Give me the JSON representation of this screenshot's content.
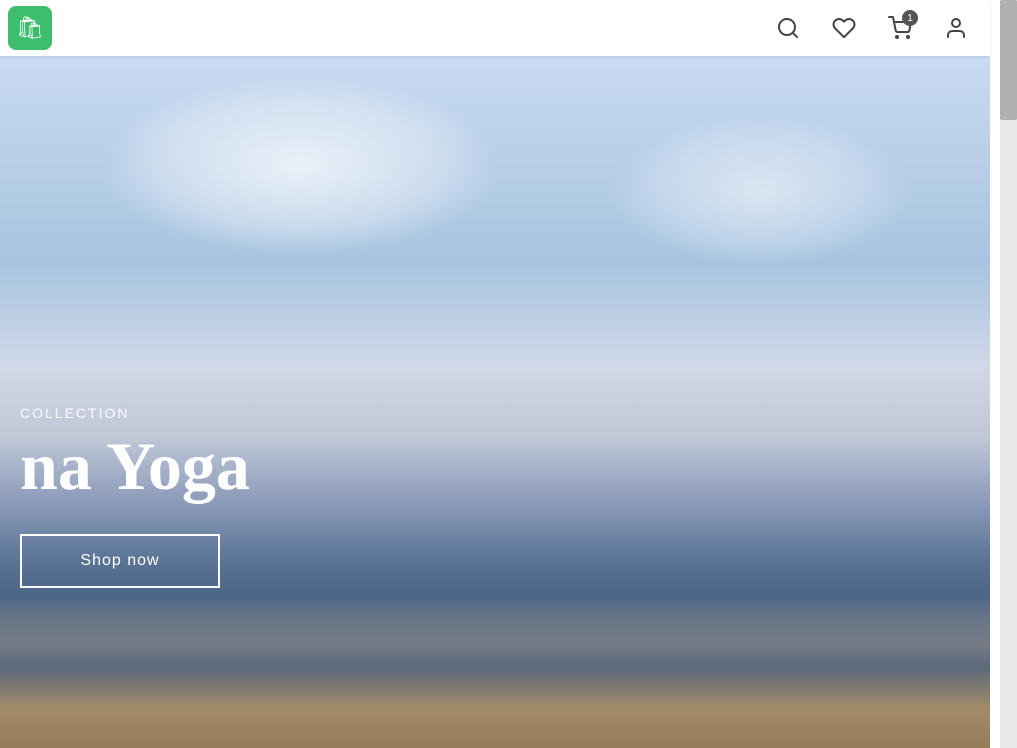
{
  "header": {
    "logo_alt": "Shop logo",
    "icons": {
      "search_label": "Search",
      "wishlist_label": "Wishlist",
      "cart_label": "Cart",
      "account_label": "Account",
      "cart_count": "1"
    }
  },
  "hero": {
    "collection_label": "COLLECTION",
    "title": "na Yoga",
    "shop_now_label": "Shop now"
  },
  "scrollbar": {
    "label": "Scrollbar"
  }
}
